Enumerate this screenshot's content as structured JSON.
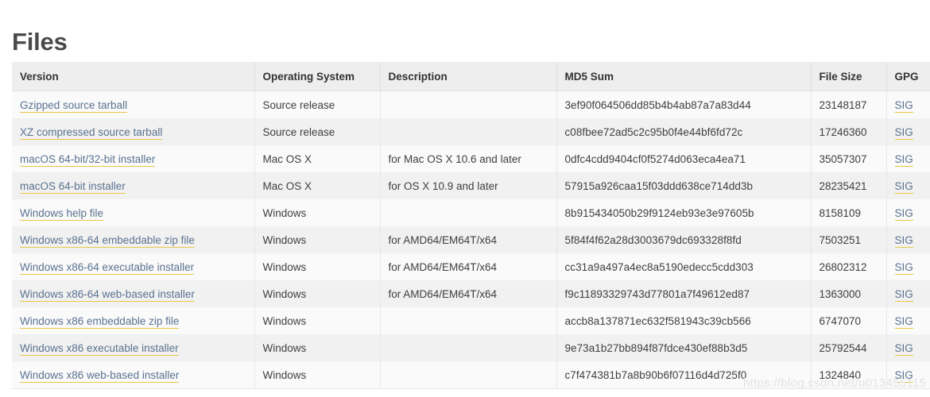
{
  "page": {
    "title": "Files",
    "watermark": "https://blog.csdn.net/u013455115"
  },
  "table": {
    "columns": [
      {
        "key": "version",
        "label": "Version"
      },
      {
        "key": "os",
        "label": "Operating System"
      },
      {
        "key": "desc",
        "label": "Description"
      },
      {
        "key": "md5",
        "label": "MD5 Sum"
      },
      {
        "key": "size",
        "label": "File Size"
      },
      {
        "key": "gpg",
        "label": "GPG"
      }
    ],
    "gpg_link_label": "SIG",
    "rows": [
      {
        "version": "Gzipped source tarball",
        "os": "Source release",
        "desc": "",
        "md5": "3ef90f064506dd85b4b4ab87a7a83d44",
        "size": "23148187",
        "gpg": "SIG"
      },
      {
        "version": "XZ compressed source tarball",
        "os": "Source release",
        "desc": "",
        "md5": "c08fbee72ad5c2c95b0f4e44bf6fd72c",
        "size": "17246360",
        "gpg": "SIG"
      },
      {
        "version": "macOS 64-bit/32-bit installer",
        "os": "Mac OS X",
        "desc": "for Mac OS X 10.6 and later",
        "md5": "0dfc4cdd9404cf0f5274d063eca4ea71",
        "size": "35057307",
        "gpg": "SIG"
      },
      {
        "version": "macOS 64-bit installer",
        "os": "Mac OS X",
        "desc": "for OS X 10.9 and later",
        "md5": "57915a926caa15f03ddd638ce714dd3b",
        "size": "28235421",
        "gpg": "SIG"
      },
      {
        "version": "Windows help file",
        "os": "Windows",
        "desc": "",
        "md5": "8b915434050b29f9124eb93e3e97605b",
        "size": "8158109",
        "gpg": "SIG"
      },
      {
        "version": "Windows x86-64 embeddable zip file",
        "os": "Windows",
        "desc": "for AMD64/EM64T/x64",
        "md5": "5f84f4f62a28d3003679dc693328f8fd",
        "size": "7503251",
        "gpg": "SIG"
      },
      {
        "version": "Windows x86-64 executable installer",
        "os": "Windows",
        "desc": "for AMD64/EM64T/x64",
        "md5": "cc31a9a497a4ec8a5190edecc5cdd303",
        "size": "26802312",
        "gpg": "SIG"
      },
      {
        "version": "Windows x86-64 web-based installer",
        "os": "Windows",
        "desc": "for AMD64/EM64T/x64",
        "md5": "f9c11893329743d77801a7f49612ed87",
        "size": "1363000",
        "gpg": "SIG"
      },
      {
        "version": "Windows x86 embeddable zip file",
        "os": "Windows",
        "desc": "",
        "md5": "accb8a137871ec632f581943c39cb566",
        "size": "6747070",
        "gpg": "SIG"
      },
      {
        "version": "Windows x86 executable installer",
        "os": "Windows",
        "desc": "",
        "md5": "9e73a1b27bb894f87fdce430ef88b3d5",
        "size": "25792544",
        "gpg": "SIG"
      },
      {
        "version": "Windows x86 web-based installer",
        "os": "Windows",
        "desc": "",
        "md5": "c7f474381b7a8b90b6f07116d4d725f0",
        "size": "1324840",
        "gpg": "SIG"
      }
    ]
  },
  "colors": {
    "link": "#5a7290",
    "link_underline": "#e8c84a",
    "header_bg": "#eeeeee",
    "row_odd_bg": "#fafafa",
    "row_even_bg": "#f1f1f1",
    "title": "#4a4a4a"
  }
}
